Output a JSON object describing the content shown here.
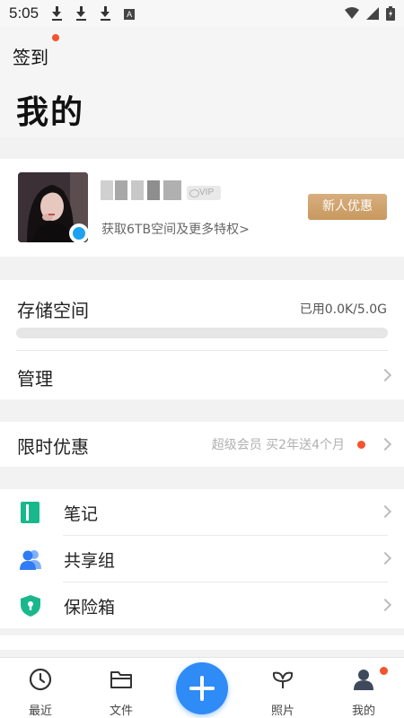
{
  "status_bar": {
    "time": "5:05",
    "notification_a": "A"
  },
  "header": {
    "signin_label": "签到",
    "title": "我的"
  },
  "profile": {
    "vip_label": "VIP",
    "promo_text": "获取6TB空间及更多特权>",
    "new_user_button": "新人优惠"
  },
  "storage": {
    "title": "存储空间",
    "used_text": "已用0.0K/5.0G",
    "used_fraction": 0.0,
    "manage_label": "管理"
  },
  "limited_offer": {
    "label": "限时优惠",
    "subtext": "超级会员 买2年送4个月"
  },
  "tools": [
    {
      "label": "笔记",
      "icon": "notebook-icon",
      "color": "#19b88c"
    },
    {
      "label": "共享组",
      "icon": "group-icon",
      "color": "#2f7cf6"
    },
    {
      "label": "保险箱",
      "icon": "shield-lock-icon",
      "color": "#19b88c"
    }
  ],
  "tabbar": {
    "recent": "最近",
    "files": "文件",
    "photos": "照片",
    "me": "我的"
  },
  "colors": {
    "accent": "#2f8bf6",
    "badge": "#f5532d",
    "gold": "#d0a36c"
  }
}
